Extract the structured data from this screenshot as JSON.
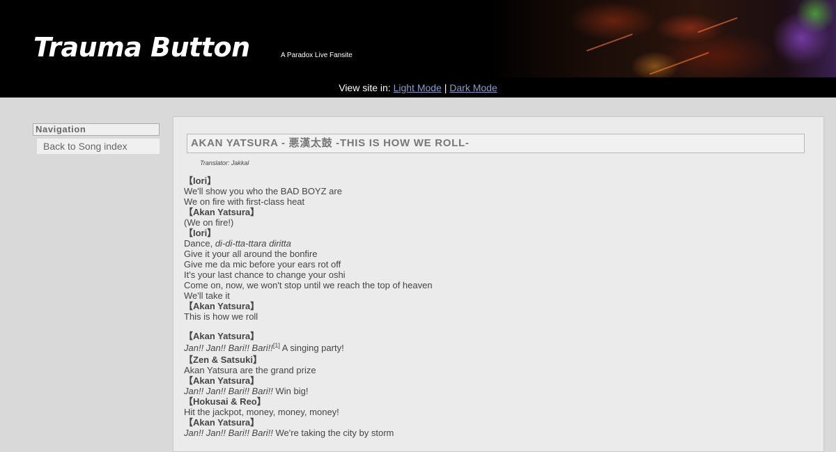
{
  "header": {
    "title": "Trauma Button",
    "tagline": "A Paradox Live Fansite"
  },
  "modebar": {
    "prefix": "View site in: ",
    "light": "Light Mode",
    "sep": " | ",
    "dark": "Dark Mode"
  },
  "nav": {
    "heading": "Navigation",
    "back": "Back to Song index"
  },
  "song": {
    "title": "AKAN YATSURA - 悪漢太鼓 -THIS IS HOW WE ROLL-",
    "translator": "Translator: Jakkal"
  },
  "lyrics": {
    "s1": "【Iori】",
    "l1": "We'll show you who the BAD BOYZ are",
    "l2": "We on fire with first-class heat",
    "s2": "【Akan Yatsura】",
    "l3": "(We on fire!)",
    "s3": "【Iori】",
    "l4a": "Dance, ",
    "l4b": "di-di-tta-ttara diritta",
    "l5": "Give it your all around the bonfire",
    "l6": "Give me da mic before your ears rot off",
    "l7": "It's your last chance to change your oshi",
    "l8": "Come on, now, we won't stop until we reach the top of heaven",
    "l9": "We'll take it",
    "s4": "【Akan Yatsura】",
    "l10": "This is how we roll",
    "s5": "【Akan Yatsura】",
    "l11a": "Jan!! Jan!! Bari!! Bari!!",
    "l11n": "[1]",
    "l11b": " A singing party!",
    "s6": "【Zen & Satsuki】",
    "l12": "Akan Yatsura are the grand prize",
    "s7": "【Akan Yatsura】",
    "l13a": "Jan!! Jan!! Bari!! Bari!!",
    "l13b": " Win big!",
    "s8": "【Hokusai & Reo】",
    "l14": "Hit the jackpot, money, money, money!",
    "s9": "【Akan Yatsura】",
    "l15a": "Jan!! Jan!! Bari!! Bari!!",
    "l15b": " We're taking the city by storm"
  }
}
